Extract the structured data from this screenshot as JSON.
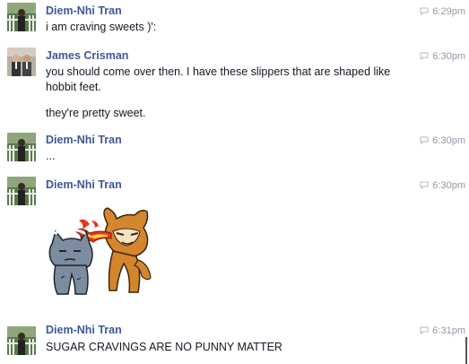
{
  "messages": [
    {
      "sender": "Diem-Nhi Tran",
      "time": "6:29pm",
      "lines": [
        "i am craving sweets )':"
      ]
    },
    {
      "sender": "James Crisman",
      "time": "6:30pm",
      "lines": [
        "you should come over then. I have these slippers that are shaped like hobbit feet.",
        "they're pretty sweet."
      ]
    },
    {
      "sender": "Diem-Nhi Tran",
      "time": "6:30pm",
      "lines": [
        "..."
      ]
    },
    {
      "sender": "Diem-Nhi Tran",
      "time": "6:30pm",
      "sticker": "cat-and-raccoon-fire-breathing-sticker"
    },
    {
      "sender": "Diem-Nhi Tran",
      "time": "6:31pm",
      "lines": [
        "SUGAR CRAVINGS ARE NO PUNNY MATTER"
      ]
    }
  ],
  "icons": {
    "timestamp": "speech-bubble-icon",
    "avatar_diem": "avatar-diem-nhi-tran",
    "avatar_james": "avatar-james-crisman"
  },
  "colors": {
    "sender_link": "#3b5998",
    "body_text": "#141823",
    "timestamp": "#9197a3"
  }
}
